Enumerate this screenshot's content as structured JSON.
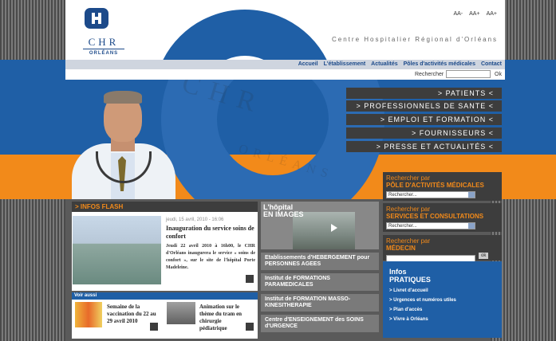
{
  "header": {
    "logo_top": "CHR",
    "logo_bottom": "ORLÉANS",
    "tagline": "Centre Hospitalier Régional d'Orléans",
    "font_sizes": [
      "AA-",
      "AA+",
      "AA+"
    ]
  },
  "nav": {
    "items": [
      "Accueil",
      "L'établissement",
      "Actualités",
      "Pôles d'activités médicales",
      "Contact"
    ]
  },
  "search": {
    "label": "Rechercher",
    "button": "Ok"
  },
  "hero": {
    "watermark": "CHR",
    "watermark2": "ORLÉANS"
  },
  "menu": {
    "items": [
      "> PATIENTS <",
      "> PROFESSIONNELS DE SANTE <",
      "> EMPLOI ET FORMATION <",
      "> FOURNISSEURS <",
      "> PRESSE ET ACTUALITÉS <"
    ]
  },
  "side": {
    "pole": {
      "t1": "Rechercher par",
      "t2": "PÔLE D'ACTIVITÉS MÉDICALES",
      "select": "Rechercher..."
    },
    "services": {
      "t1": "Rechercher par",
      "t2": "SERVICES ET CONSULTATIONS",
      "select": "Rechercher..."
    },
    "medecin": {
      "t1": "Rechercher par",
      "t2": "MÉDECIN",
      "button": "ok"
    },
    "infos": {
      "h1": "Infos",
      "h2": "PRATIQUES",
      "links": [
        "> Livret d'accueil",
        "> Urgences et numéros utiles",
        "> Plan d'accès",
        "> Vivre à Orléans"
      ]
    }
  },
  "flash": {
    "title": "> INFOS FLASH",
    "date": "jeudi, 15 avril, 2010 - 16:06",
    "headline": "Inauguration du service soins de confort",
    "body_bold": "Jeudi 22 avril 2010 à 16h00, le CHR d'Orléans inaugurera le service « soins de confort », sur le site de l'hôpital Porte Madeleine."
  },
  "voir": {
    "title": "Voir aussi",
    "item1": "Semaine de la vaccination du 22 au 29 avril 2010",
    "item2": "Animation sur le thème du tram en chirurgie pédiatrique"
  },
  "center": {
    "hopital1": "L'hôpital",
    "hopital2": "EN IMAGES",
    "btn1": "Etablissements d'HEBERGEMENT pour PERSONNES AGEES",
    "btn2": "Institut de FORMATIONS PARAMEDICALES",
    "btn3": "Institut de FORMATION MASSO-KINESITHERAPIE",
    "btn4": "Centre d'ENSEIGNEMENT des SOINS d'URGENCE"
  },
  "colors": {
    "blue": "#1f5fa6",
    "orange": "#f28a1a",
    "dark": "#3d3d3d"
  }
}
